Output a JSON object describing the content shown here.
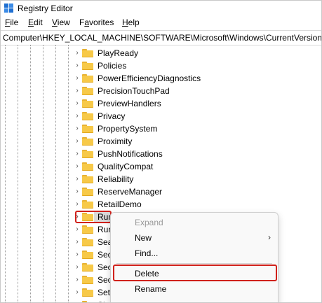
{
  "window": {
    "title": "Registry Editor"
  },
  "menu": [
    {
      "underline": "F",
      "rest": "ile"
    },
    {
      "underline": "E",
      "rest": "dit"
    },
    {
      "underline": "V",
      "rest": "iew"
    },
    {
      "pre": "F",
      "underline": "a",
      "rest": "vorites"
    },
    {
      "underline": "H",
      "rest": "elp"
    }
  ],
  "address": "Computer\\HKEY_LOCAL_MACHINE\\SOFTWARE\\Microsoft\\Windows\\CurrentVersion\\",
  "tree": {
    "items": [
      "PlayReady",
      "Policies",
      "PowerEfficiencyDiagnostics",
      "PrecisionTouchPad",
      "PreviewHandlers",
      "Privacy",
      "PropertySystem",
      "Proximity",
      "PushNotifications",
      "QualityCompat",
      "Reliability",
      "ReserveManager",
      "RetailDemo",
      "Run",
      "Run",
      "Sea",
      "Sec",
      "Sec",
      "Sec",
      "Sett",
      "Sh"
    ],
    "selected_index": 13
  },
  "context_menu": {
    "expand": "Expand",
    "new": "New",
    "find": "Find...",
    "delete": "Delete",
    "rename": "Rename"
  },
  "colors": {
    "highlight": "#d0211b",
    "folder": "#f7c948"
  }
}
